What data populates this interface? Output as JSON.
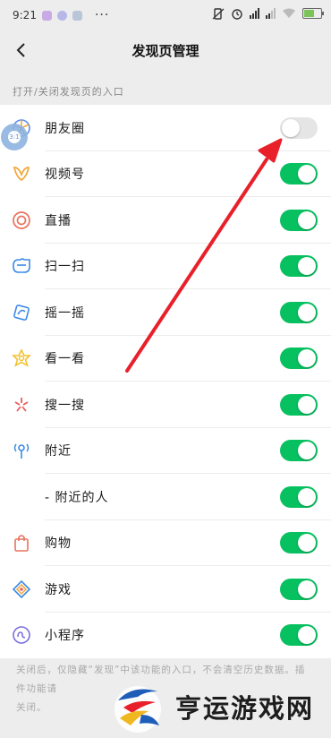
{
  "status_bar": {
    "time": "9:21",
    "dots": "···",
    "battery": "66",
    "battery_level": 0.66
  },
  "header": {
    "title": "发现页管理",
    "back_icon": "chevron-left-icon"
  },
  "section_label": "打开/关闭发现页的入口",
  "items": [
    {
      "label": "朋友圈",
      "icon": "moments-icon",
      "on": false
    },
    {
      "label": "视频号",
      "icon": "channels-icon",
      "on": true
    },
    {
      "label": "直播",
      "icon": "live-icon",
      "on": true
    },
    {
      "label": "扫一扫",
      "icon": "scan-icon",
      "on": true
    },
    {
      "label": "摇一摇",
      "icon": "shake-icon",
      "on": true
    },
    {
      "label": "看一看",
      "icon": "top-stories-icon",
      "on": true
    },
    {
      "label": "搜一搜",
      "icon": "search-icon",
      "on": true
    },
    {
      "label": "附近",
      "icon": "nearby-icon",
      "on": true
    },
    {
      "label": "- 附近的人",
      "icon": "",
      "on": true
    },
    {
      "label": "购物",
      "icon": "shopping-icon",
      "on": true
    },
    {
      "label": "游戏",
      "icon": "games-icon",
      "on": true
    },
    {
      "label": "小程序",
      "icon": "mini-programs-icon",
      "on": true
    }
  ],
  "footnote": "关闭后，仅隐藏“发现”中该功能的入口，不会清空历史数据。插件功能请",
  "footnote_tail": "关闭。",
  "floating_bubble": "3:1",
  "watermark": {
    "text": "亨运游戏网"
  },
  "colors": {
    "accent": "#07c160",
    "toggle_off": "#e5e5e5",
    "arrow": "#e8202a",
    "background": "#ededed"
  }
}
